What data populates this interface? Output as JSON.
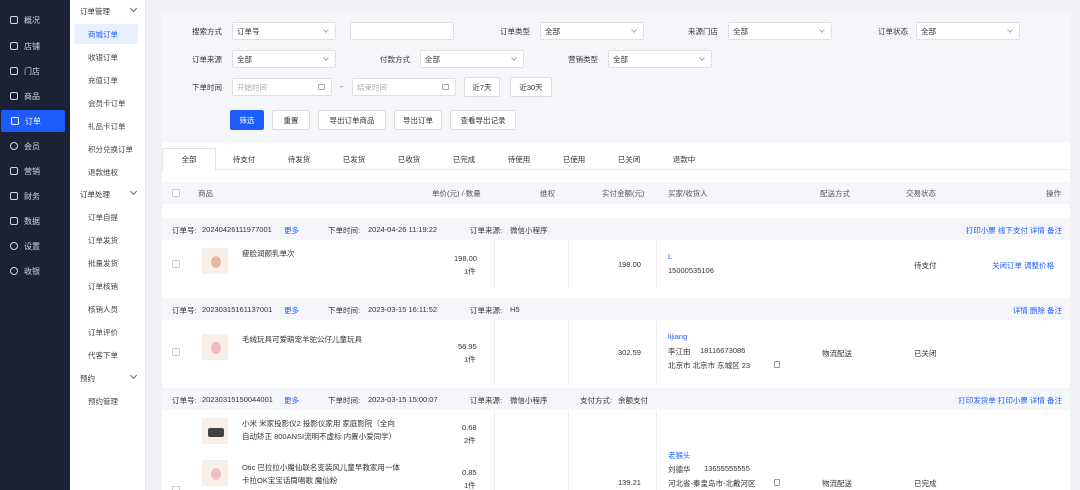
{
  "nav": {
    "items": [
      "概况",
      "店铺",
      "门店",
      "商品",
      "订单",
      "会员",
      "营销",
      "财务",
      "数据",
      "设置",
      "收银"
    ],
    "active_index": 4
  },
  "subnav": {
    "group1": "订单管理",
    "group1_items": [
      "商城订单",
      "收银订单",
      "充值订单",
      "会员卡订单",
      "礼品卡订单",
      "积分兑换订单",
      "退款维权"
    ],
    "group2": "订单处理",
    "group2_items": [
      "订单自提",
      "订单发货",
      "批量发货",
      "订单核销",
      "核销人员",
      "订单评价",
      "代客下单"
    ],
    "group3": "预约",
    "group3_items": [
      "预约管理"
    ],
    "active": "商城订单"
  },
  "filters": {
    "search_type_label": "搜索方式",
    "search_type_value": "订单号",
    "search_input_value": "",
    "order_type_label": "订单类型",
    "order_type_value": "全部",
    "source_store_label": "来源门店",
    "source_store_value": "全部",
    "order_status_label": "订单状态",
    "order_status_value": "全部",
    "order_source_label": "订单来源",
    "order_source_value": "全部",
    "pay_method_label": "付款方式",
    "pay_method_value": "全部",
    "marketing_type_label": "营销类型",
    "marketing_type_value": "全部",
    "order_time_label": "下单时间",
    "start_placeholder": "开始时间",
    "end_placeholder": "结束时间",
    "range_sep": "-",
    "last7": "近7天",
    "last30": "近30天",
    "btn_filter": "筛选",
    "btn_reset": "重置",
    "btn_export_goods": "导出订单商品",
    "btn_export_orders": "导出订单",
    "btn_export_log": "查看导出记录"
  },
  "tabs": [
    "全部",
    "待支付",
    "待发货",
    "已发货",
    "已收货",
    "已完成",
    "待使用",
    "已使用",
    "已关闭",
    "退款中"
  ],
  "columns": {
    "goods": "商品",
    "price_qty": "单价(元) / 数量",
    "rights": "维权",
    "paid": "实付金额(元)",
    "buyer": "买家/收货人",
    "delivery": "配送方式",
    "status": "交易状态",
    "ops": "操作"
  },
  "orders": [
    {
      "order_no_label": "订单号:",
      "order_no": "20240426111977001",
      "more": "更多",
      "time_label": "下单时间:",
      "time": "2024-04-26 11:19:22",
      "source_label": "订单来源:",
      "source": "微信小程序",
      "actions": "打印小票  线下支付  详情  备注",
      "goods_name": "瘦脸润颜乳单次",
      "price": "198.00",
      "qty": "1件",
      "paid": "198.00",
      "buyer_name": "L",
      "buyer_phone": "15000535106",
      "status": "待支付",
      "row_actions": "关闭订单  调整价格"
    },
    {
      "order_no_label": "订单号:",
      "order_no": "20230315161137001",
      "more": "更多",
      "time_label": "下单时间:",
      "time": "2023-03-15 16:11:52",
      "source_label": "订单来源:",
      "source": "H5",
      "actions": "详情  删除  备注",
      "goods_name": "毛绒玩具可爱萌宠羊驼公仔儿童玩具",
      "price": "56.95",
      "qty": "1件",
      "paid": "302.59",
      "buyer_name": "lijiang",
      "receiver_name": "李江由",
      "receiver_phone": "18116673086",
      "address": "北京市 北京市 东城区 23",
      "delivery": "物流配送",
      "status": "已关闭"
    },
    {
      "order_no_label": "订单号:",
      "order_no": "20230315150044001",
      "more": "更多",
      "time_label": "下单时间:",
      "time": "2023-03-15 15:00:07",
      "source_label": "订单来源:",
      "source": "微信小程序",
      "pay_label": "支付方式:",
      "pay": "余额支付",
      "actions": "打印发货单  打印小票  详情  备注",
      "goods1_line1": "小米 米家投影仪2 投影仪家用 家庭影院（全向",
      "goods1_line2": "自动矫正 800ANSI流明不虚标 内置小爱同学）",
      "price1": "0.68",
      "qty1": "2件",
      "goods2_line1": "Otic 巴拉拉小魔仙联名变装风儿童早教家用一体",
      "goods2_line2": "卡拉OK宝宝话筒唱歌 魔仙粉",
      "price2": "0.85",
      "qty2": "1件",
      "paid": "139.21",
      "buyer_name": "老猴头",
      "receiver_name": "刘德华",
      "receiver_phone": "13655555555",
      "address": "河北省-秦皇岛市-北戴河区",
      "delivery": "物流配送",
      "status": "已完成"
    }
  ]
}
